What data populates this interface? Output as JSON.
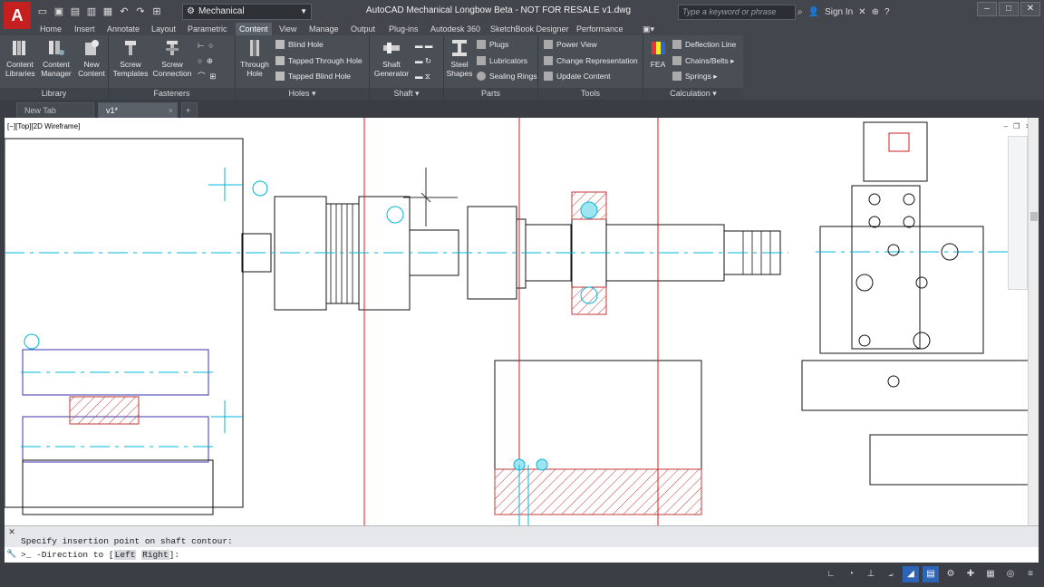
{
  "app": {
    "logo_letter": "A",
    "window_title": "AutoCAD Mechanical Longbow Beta - NOT FOR RESALE     v1.dwg",
    "workspace": "Mechanical",
    "search_placeholder": "Type a keyword or phrase",
    "sign_in": "Sign In",
    "help": "?"
  },
  "ribbon_tabs": [
    "Home",
    "Insert",
    "Annotate",
    "Layout",
    "Parametric",
    "Content",
    "View",
    "Manage",
    "Output",
    "Plug-ins",
    "Autodesk 360",
    "SketchBook Designer",
    "Performance"
  ],
  "active_tab": "Content",
  "panels": {
    "library": {
      "title": "Library",
      "buttons": [
        "Content Libraries",
        "Content Manager",
        "New Content"
      ]
    },
    "fasteners": {
      "title": "Fasteners",
      "buttons": [
        "Screw Templates",
        "Screw Connection"
      ]
    },
    "holes": {
      "title": "Holes",
      "big": "Through Hole",
      "items": [
        "Blind Hole",
        "Tapped Through Hole",
        "Tapped Blind Hole"
      ]
    },
    "shaft": {
      "title": "Shaft",
      "big": "Shaft Generator"
    },
    "parts": {
      "title": "Parts",
      "big": "Steel Shapes",
      "items": [
        "Plugs",
        "Lubricators",
        "Sealing Rings"
      ]
    },
    "tools": {
      "title": "Tools",
      "items": [
        "Power View",
        "Change Representation",
        "Update Content"
      ]
    },
    "calculation": {
      "title": "Calculation",
      "big": "FEA",
      "items": [
        "Deflection Line",
        "Chains/Belts",
        "Springs"
      ]
    }
  },
  "doc_tabs": [
    {
      "label": "New Tab",
      "active": false
    },
    {
      "label": "v1*",
      "active": true
    }
  ],
  "viewport": {
    "label": "[−][Top][2D Wireframe]"
  },
  "command_line": {
    "history": "Specify insertion point on shaft contour:",
    "prompt_prefix": "-Direction to [",
    "option_left": "Left",
    "option_right": "Right",
    "prompt_suffix": "]:"
  },
  "colors": {
    "cyan_centerline": "#00b7d9",
    "red_guide": "#d21e1e",
    "hatch": "#c23a3a",
    "outline": "#111111",
    "blue_outline": "#3a35a8"
  },
  "status_icons": [
    "grid-icon",
    "snap-icon",
    "ortho-icon",
    "polar-icon",
    "osnap-icon",
    "workspace-icon",
    "annotation-icon",
    "isolate-icon",
    "hardware-icon",
    "clean-screen-icon",
    "customize-icon"
  ]
}
